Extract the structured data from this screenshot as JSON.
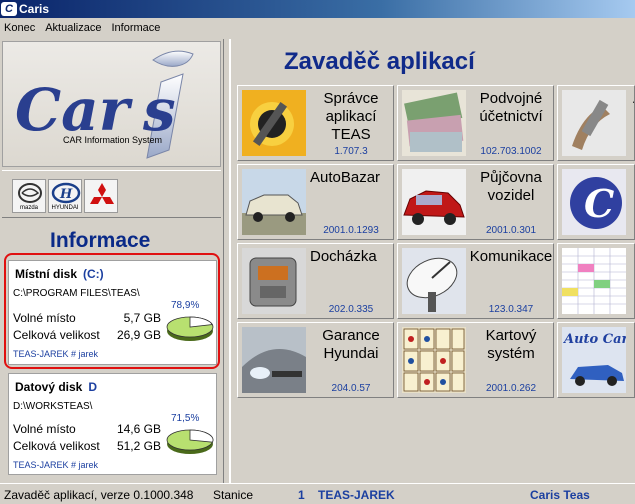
{
  "window": {
    "title": "Caris",
    "icon": "caris-c-icon"
  },
  "menu": [
    "Konec",
    "Aktualizace",
    "Informace"
  ],
  "logo": {
    "wordmark": "Caris",
    "tagline": "CAR Information System"
  },
  "brands": [
    "mazda",
    "HYUNDAI",
    "mitsubishi-logo-icon"
  ],
  "info": {
    "title": "Informace",
    "local_disk": {
      "title": "Místní disk",
      "letter": "(C:)",
      "path": "C:\\PROGRAM FILES\\TEAS\\",
      "free_label": "Volné místo",
      "free_value": "5,7",
      "free_unit": "GB",
      "total_label": "Celková velikost",
      "total_value": "26,9",
      "total_unit": "GB",
      "percent": "78,9%",
      "used_fraction": 0.789,
      "user": "TEAS-JAREK # jarek"
    },
    "data_disk": {
      "title": "Datový disk",
      "letter": "D",
      "path": "D:\\WORKSTEAS\\",
      "free_label": "Volné místo",
      "free_value": "14,6",
      "free_unit": "GB",
      "total_label": "Celková velikost",
      "total_value": "51,2",
      "total_unit": "GB",
      "percent": "71,5%",
      "used_fraction": 0.715,
      "user": "TEAS-JAREK # jarek"
    }
  },
  "main": {
    "title": "Zavaděč aplikací",
    "tiles": [
      {
        "name": "Správce aplikací TEAS",
        "version": "1.707.3",
        "icon": "sun-wrench-icon"
      },
      {
        "name": "Podvojné účetnictví",
        "version": "102.703.1002",
        "icon": "banknotes-icon"
      },
      {
        "name": "A",
        "version": "",
        "icon": "wrench-hand-icon"
      },
      {
        "name": "AutoBazar",
        "version": "2001.0.1293",
        "icon": "old-car-icon"
      },
      {
        "name": "Půjčovna vozidel",
        "version": "2001.0.301",
        "icon": "red-car-icon"
      },
      {
        "name": "",
        "version": "",
        "icon": "caris-c-icon"
      },
      {
        "name": "Docházka",
        "version": "202.0.335",
        "icon": "time-clock-icon"
      },
      {
        "name": "Komunikace",
        "version": "123.0.347",
        "icon": "satellite-dish-icon"
      },
      {
        "name": "",
        "version": "",
        "icon": "spreadsheet-icon"
      },
      {
        "name": "Garance Hyundai",
        "version": "204.0.57",
        "icon": "car-front-icon"
      },
      {
        "name": "Kartový systém",
        "version": "2001.0.262",
        "icon": "playing-cards-icon"
      },
      {
        "name": "",
        "version": "",
        "icon": "autocaris-logo-icon",
        "logo_text": "Auto Car s"
      }
    ]
  },
  "status": {
    "version_text": "Zavaděč aplikací, verze",
    "version": "0.1000.348",
    "station_label": "Stanice",
    "station_no": "1",
    "station_name": "TEAS-JAREK",
    "user": "Caris Teas"
  }
}
